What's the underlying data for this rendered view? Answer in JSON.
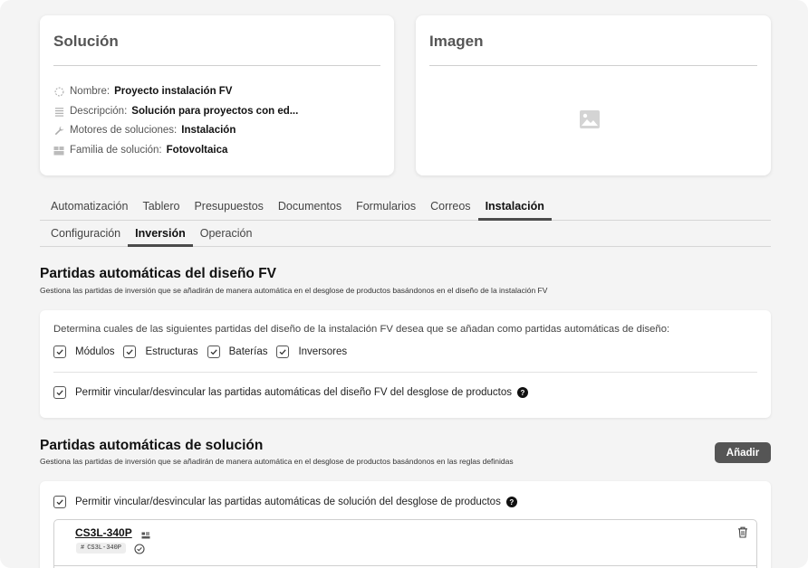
{
  "solution_card": {
    "title": "Solución",
    "fields": [
      {
        "label": "Nombre:",
        "value": "Proyecto instalación FV",
        "icon": "circle-dashed-icon"
      },
      {
        "label": "Descripción:",
        "value": "Solución para proyectos con ed...",
        "icon": "lines-icon"
      },
      {
        "label": "Motores de soluciones:",
        "value": "Instalación",
        "icon": "wrench-icon"
      },
      {
        "label": "Familia de solución:",
        "value": "Fotovoltaica",
        "icon": "boxes-icon"
      }
    ]
  },
  "image_card": {
    "title": "Imagen",
    "icon": "image-placeholder-icon"
  },
  "main_tabs": [
    "Automatización",
    "Tablero",
    "Presupuestos",
    "Documentos",
    "Formularios",
    "Correos",
    "Instalación"
  ],
  "main_tabs_active": "Instalación",
  "sub_tabs": [
    "Configuración",
    "Inversión",
    "Operación"
  ],
  "sub_tabs_active": "Inversión",
  "design_section": {
    "title": "Partidas automáticas del diseño FV",
    "subtitle": "Gestiona las partidas de inversión que se añadirán de manera automática en el desglose de productos basándonos en el diseño de la instalación FV",
    "prompt": "Determina cuales de las siguientes partidas del diseño de la instalación FV desea que se añadan como partidas automáticas de diseño:",
    "options": [
      {
        "label": "Módulos",
        "checked": true
      },
      {
        "label": "Estructuras",
        "checked": true
      },
      {
        "label": "Baterías",
        "checked": true
      },
      {
        "label": "Inversores",
        "checked": true
      }
    ],
    "link_option": {
      "label": "Permitir vincular/desvincular las partidas automáticas del diseño FV del desglose de productos",
      "checked": true
    }
  },
  "solution_section": {
    "title": "Partidas automáticas de solución",
    "subtitle": "Gestiona las partidas de inversión que se añadirán de manera automática en el desglose de productos basándonos en las reglas definidas",
    "add_label": "Añadir",
    "link_option": {
      "label": "Permitir vincular/desvincular las partidas automáticas de solución del desglose de productos",
      "checked": true
    },
    "item": {
      "name": "CS3L-340P",
      "tag": "CS3L-340P"
    }
  },
  "colors": {
    "accent": "#4b4b4b",
    "button": "#555555",
    "background": "#f4f4f4"
  }
}
